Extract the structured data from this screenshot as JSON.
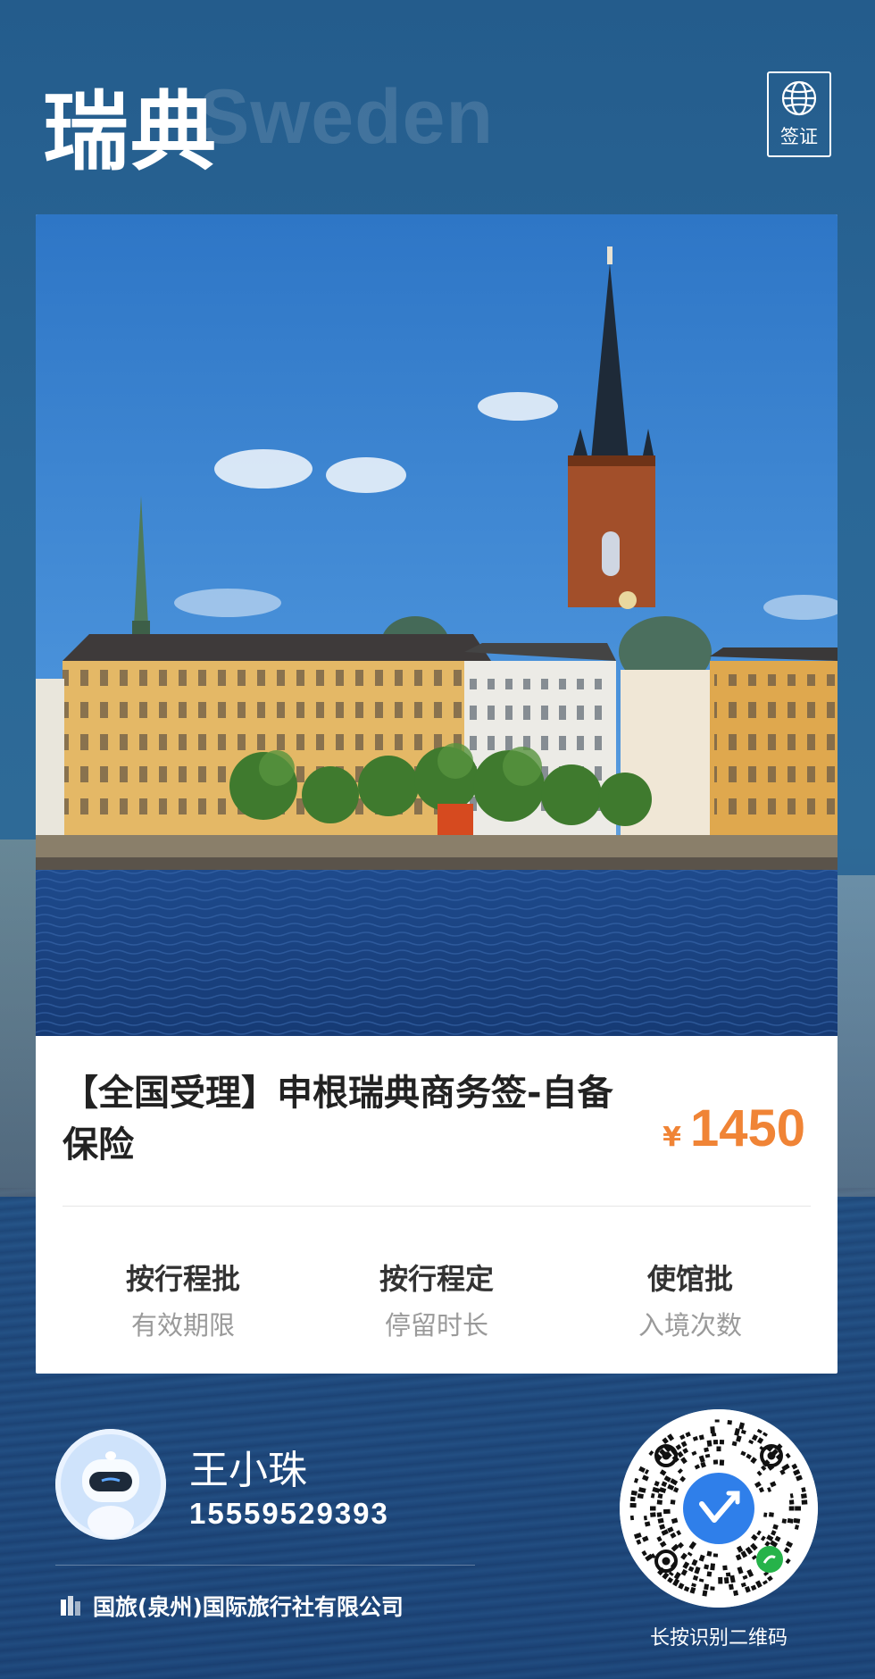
{
  "header": {
    "title_cn": "瑞典",
    "title_en": "Sweden",
    "visa_badge": {
      "icon": "globe-icon",
      "label": "签证"
    }
  },
  "product": {
    "title": "【全国受理】申根瑞典商务签-自备保险",
    "currency": "¥",
    "price": "1450",
    "price_color": "#f08436"
  },
  "facts": [
    {
      "value": "按行程批",
      "label": "有效期限"
    },
    {
      "value": "按行程定",
      "label": "停留时长"
    },
    {
      "value": "使馆批",
      "label": "入境次数"
    }
  ],
  "agent": {
    "name": "王小珠",
    "phone": "15559529393",
    "company": "国旅(泉州)国际旅行社有限公司"
  },
  "qr": {
    "caption": "长按识别二维码"
  }
}
